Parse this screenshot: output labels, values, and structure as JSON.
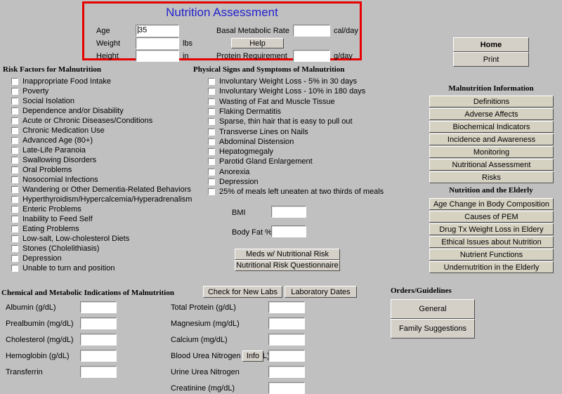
{
  "header": {
    "title": "Nutrition Assessment",
    "accent_border_color": "#e60000",
    "title_color": "#2222cc",
    "fields": [
      {
        "label": "Age",
        "value": "35",
        "unit": ""
      },
      {
        "label": "Weight",
        "value": "",
        "unit": "lbs"
      },
      {
        "label": "Height",
        "value": "",
        "unit": "in"
      }
    ],
    "right_fields": [
      {
        "label": "Basal Metabolic Rate",
        "value": "",
        "unit": "cal/day"
      },
      {
        "label": "Protein Requirement",
        "value": "",
        "unit": "g/day"
      }
    ],
    "help_label": "Help"
  },
  "risk_factors": {
    "heading": "Risk Factors for Malnutrition",
    "items": [
      "Inappropriate Food Intake",
      "Poverty",
      "Social Isolation",
      "Dependence and/or Disability",
      "Acute or Chronic Diseases/Conditions",
      "Chronic Medication Use",
      "Advanced Age (80+)",
      "Late-Life Paranoia",
      "Swallowing Disorders",
      "Oral Problems",
      "Nosocomial Infections",
      "Wandering or Other Dementia-Related Behaviors",
      "Hyperthyroidism/Hypercalcemia/Hyperadrenalism",
      "Enteric Problems",
      "Inability to Feed Self",
      "Eating Problems",
      "Low-salt, Low-cholesterol Diets",
      "Stones (Cholelithiasis)",
      "Depression",
      "Unable to turn and position"
    ]
  },
  "physical_signs": {
    "heading": "Physical Signs and Symptoms of Malnutrition",
    "items": [
      "Involuntary Weight Loss - 5% in 30 days",
      "Involuntary Weight Loss - 10% in 180 days",
      "Wasting of Fat and Muscle Tissue",
      "Flaking Dermatitis",
      "Sparse, thin hair that is easy to pull out",
      "Transverse Lines on Nails",
      "Abdominal Distension",
      "Hepatogmegaly",
      "Parotid Gland Enlargement",
      "Anorexia",
      "Depression",
      "25% of meals left uneaten at two thirds of meals"
    ],
    "measures": [
      {
        "label": "BMI",
        "value": ""
      },
      {
        "label": "Body Fat %",
        "value": ""
      }
    ],
    "buttons": [
      "Meds w/ Nutritional Risk",
      "Nutritional Risk Questionnaire"
    ]
  },
  "sidebar": {
    "top_buttons": [
      {
        "label": "Home",
        "bold": true
      },
      {
        "label": "Print",
        "bold": false
      }
    ],
    "malnutrition_info": {
      "heading": "Malnutrition Information",
      "items": [
        "Definitions",
        "Adverse Affects",
        "Biochemical Indicators",
        "Incidence and Awareness",
        "Monitoring",
        "Nutritional Assessment",
        "Risks"
      ]
    },
    "elderly": {
      "heading": "Nutrition and the Elderly",
      "items": [
        "Age Change in Body Composition",
        "Causes of PEM",
        "Drug Tx Weight Loss in Eldery",
        "Ethical Issues about Nutrition",
        "Nutrient Functions",
        "Undernutrition in the Elderly"
      ]
    }
  },
  "orders": {
    "heading": "Orders/Guidelines",
    "items": [
      "General",
      "Family Suggestions"
    ]
  },
  "labs": {
    "heading": "Chemical and Metabolic Indications of Malnutrition",
    "toolbar": [
      "Check for New Labs",
      "Laboratory Dates"
    ],
    "left_fields": [
      {
        "label": "Albumin (g/dL)",
        "value": ""
      },
      {
        "label": "Prealbumin (mg/dL)",
        "value": ""
      },
      {
        "label": "Cholesterol (mg/dL)",
        "value": ""
      },
      {
        "label": "Hemoglobin (g/dL)",
        "value": ""
      },
      {
        "label": "Transferrin",
        "value": ""
      }
    ],
    "right_fields": [
      {
        "label": "Total Protein (g/dL)",
        "value": ""
      },
      {
        "label": "Magnesium (mg/dL)",
        "value": ""
      },
      {
        "label": "Calcium (mg/dL)",
        "value": ""
      },
      {
        "label": "Blood Urea Nitrogen (mg/dL)",
        "value": ""
      },
      {
        "label": "Urine Urea Nitrogen",
        "value": ""
      },
      {
        "label": "Creatinine (mg/dL)",
        "value": ""
      }
    ],
    "info_button": "Info"
  }
}
